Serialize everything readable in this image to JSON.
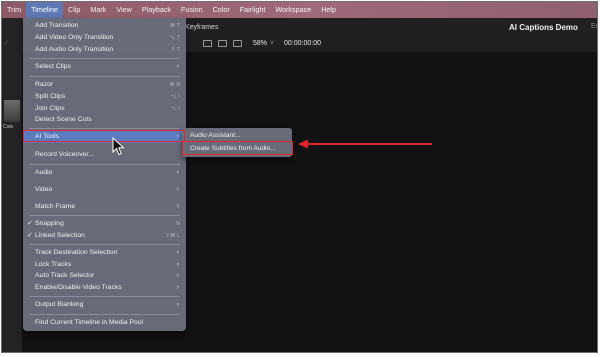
{
  "menubar": {
    "items": [
      "Trim",
      "Timeline",
      "Clip",
      "Mark",
      "View",
      "Playback",
      "Fusion",
      "Color",
      "Fairlight",
      "Workspace",
      "Help"
    ],
    "active_index": 1
  },
  "viewer": {
    "keyframes_label": "Keyframes",
    "zoom": "58%",
    "timecode": "00:00:00:00",
    "project_title": "AI Captions Demo",
    "project_tag": "Ed",
    "left_thumb_label": "Colo"
  },
  "menu": {
    "add_transition": "Add Transition",
    "add_video_only_transition": "Add Video Only Transition",
    "add_audio_only_transition": "Add Audio Only Transition",
    "select_clips": "Select Clips",
    "razor": "Razor",
    "split_clips": "Split Clips",
    "join_clips": "Join Clips",
    "detect_scene_cuts": "Detect Scene Cuts",
    "ai_tools": "AI Tools",
    "record_voiceover": "Record Voiceover...",
    "audio": "Audio",
    "video": "Video",
    "match_frame": "Match Frame",
    "snapping": "Snapping",
    "linked_selection": "Linked Selection",
    "track_destination_selection": "Track Destination Selection",
    "lock_tracks": "Lock Tracks",
    "auto_track_selector": "Auto Track Selector",
    "enable_disable_video_tracks": "Enable/Disable Video Tracks",
    "output_blanking": "Output Blanking",
    "find_current_timeline": "Find Current Timeline in Media Pool",
    "check_mark": "✓"
  },
  "submenu": {
    "audio_assistant": "Audio Assistant...",
    "create_subtitles": "Create Subtitles from Audio..."
  },
  "colors": {
    "highlight": "#5a7bc0",
    "annotation_red": "#e2262b",
    "menu_bg": "#6a6e7b"
  },
  "icons": [
    "chevron-right-icon",
    "checkmark-icon",
    "cursor-icon",
    "red-arrow-icon"
  ]
}
